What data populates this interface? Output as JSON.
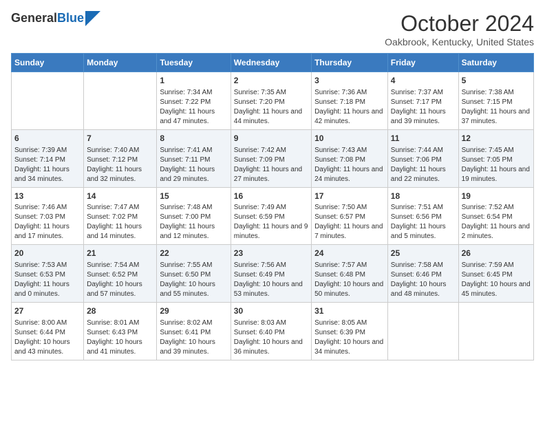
{
  "header": {
    "logo_line1": "General",
    "logo_line2": "Blue",
    "month": "October 2024",
    "location": "Oakbrook, Kentucky, United States"
  },
  "days_of_week": [
    "Sunday",
    "Monday",
    "Tuesday",
    "Wednesday",
    "Thursday",
    "Friday",
    "Saturday"
  ],
  "weeks": [
    [
      {
        "day": "",
        "data": ""
      },
      {
        "day": "",
        "data": ""
      },
      {
        "day": "1",
        "data": "Sunrise: 7:34 AM\nSunset: 7:22 PM\nDaylight: 11 hours and 47 minutes."
      },
      {
        "day": "2",
        "data": "Sunrise: 7:35 AM\nSunset: 7:20 PM\nDaylight: 11 hours and 44 minutes."
      },
      {
        "day": "3",
        "data": "Sunrise: 7:36 AM\nSunset: 7:18 PM\nDaylight: 11 hours and 42 minutes."
      },
      {
        "day": "4",
        "data": "Sunrise: 7:37 AM\nSunset: 7:17 PM\nDaylight: 11 hours and 39 minutes."
      },
      {
        "day": "5",
        "data": "Sunrise: 7:38 AM\nSunset: 7:15 PM\nDaylight: 11 hours and 37 minutes."
      }
    ],
    [
      {
        "day": "6",
        "data": "Sunrise: 7:39 AM\nSunset: 7:14 PM\nDaylight: 11 hours and 34 minutes."
      },
      {
        "day": "7",
        "data": "Sunrise: 7:40 AM\nSunset: 7:12 PM\nDaylight: 11 hours and 32 minutes."
      },
      {
        "day": "8",
        "data": "Sunrise: 7:41 AM\nSunset: 7:11 PM\nDaylight: 11 hours and 29 minutes."
      },
      {
        "day": "9",
        "data": "Sunrise: 7:42 AM\nSunset: 7:09 PM\nDaylight: 11 hours and 27 minutes."
      },
      {
        "day": "10",
        "data": "Sunrise: 7:43 AM\nSunset: 7:08 PM\nDaylight: 11 hours and 24 minutes."
      },
      {
        "day": "11",
        "data": "Sunrise: 7:44 AM\nSunset: 7:06 PM\nDaylight: 11 hours and 22 minutes."
      },
      {
        "day": "12",
        "data": "Sunrise: 7:45 AM\nSunset: 7:05 PM\nDaylight: 11 hours and 19 minutes."
      }
    ],
    [
      {
        "day": "13",
        "data": "Sunrise: 7:46 AM\nSunset: 7:03 PM\nDaylight: 11 hours and 17 minutes."
      },
      {
        "day": "14",
        "data": "Sunrise: 7:47 AM\nSunset: 7:02 PM\nDaylight: 11 hours and 14 minutes."
      },
      {
        "day": "15",
        "data": "Sunrise: 7:48 AM\nSunset: 7:00 PM\nDaylight: 11 hours and 12 minutes."
      },
      {
        "day": "16",
        "data": "Sunrise: 7:49 AM\nSunset: 6:59 PM\nDaylight: 11 hours and 9 minutes."
      },
      {
        "day": "17",
        "data": "Sunrise: 7:50 AM\nSunset: 6:57 PM\nDaylight: 11 hours and 7 minutes."
      },
      {
        "day": "18",
        "data": "Sunrise: 7:51 AM\nSunset: 6:56 PM\nDaylight: 11 hours and 5 minutes."
      },
      {
        "day": "19",
        "data": "Sunrise: 7:52 AM\nSunset: 6:54 PM\nDaylight: 11 hours and 2 minutes."
      }
    ],
    [
      {
        "day": "20",
        "data": "Sunrise: 7:53 AM\nSunset: 6:53 PM\nDaylight: 11 hours and 0 minutes."
      },
      {
        "day": "21",
        "data": "Sunrise: 7:54 AM\nSunset: 6:52 PM\nDaylight: 10 hours and 57 minutes."
      },
      {
        "day": "22",
        "data": "Sunrise: 7:55 AM\nSunset: 6:50 PM\nDaylight: 10 hours and 55 minutes."
      },
      {
        "day": "23",
        "data": "Sunrise: 7:56 AM\nSunset: 6:49 PM\nDaylight: 10 hours and 53 minutes."
      },
      {
        "day": "24",
        "data": "Sunrise: 7:57 AM\nSunset: 6:48 PM\nDaylight: 10 hours and 50 minutes."
      },
      {
        "day": "25",
        "data": "Sunrise: 7:58 AM\nSunset: 6:46 PM\nDaylight: 10 hours and 48 minutes."
      },
      {
        "day": "26",
        "data": "Sunrise: 7:59 AM\nSunset: 6:45 PM\nDaylight: 10 hours and 45 minutes."
      }
    ],
    [
      {
        "day": "27",
        "data": "Sunrise: 8:00 AM\nSunset: 6:44 PM\nDaylight: 10 hours and 43 minutes."
      },
      {
        "day": "28",
        "data": "Sunrise: 8:01 AM\nSunset: 6:43 PM\nDaylight: 10 hours and 41 minutes."
      },
      {
        "day": "29",
        "data": "Sunrise: 8:02 AM\nSunset: 6:41 PM\nDaylight: 10 hours and 39 minutes."
      },
      {
        "day": "30",
        "data": "Sunrise: 8:03 AM\nSunset: 6:40 PM\nDaylight: 10 hours and 36 minutes."
      },
      {
        "day": "31",
        "data": "Sunrise: 8:05 AM\nSunset: 6:39 PM\nDaylight: 10 hours and 34 minutes."
      },
      {
        "day": "",
        "data": ""
      },
      {
        "day": "",
        "data": ""
      }
    ]
  ]
}
